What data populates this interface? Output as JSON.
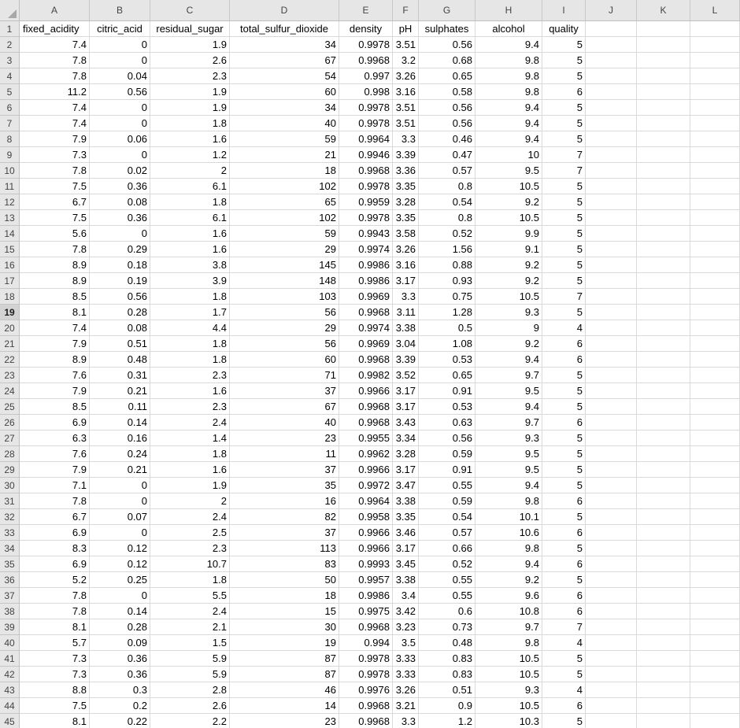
{
  "columns": [
    "A",
    "B",
    "C",
    "D",
    "E",
    "F",
    "G",
    "H",
    "I",
    "J",
    "K",
    "L"
  ],
  "headers": [
    "fixed_acidity",
    "citric_acid",
    "residual_sugar",
    "total_sulfur_dioxide",
    "density",
    "pH",
    "sulphates",
    "alcohol",
    "quality"
  ],
  "active_row": 19,
  "row_numbers": [
    "1",
    "2",
    "3",
    "4",
    "5",
    "6",
    "7",
    "8",
    "9",
    "10",
    "11",
    "12",
    "13",
    "14",
    "15",
    "16",
    "17",
    "18",
    "19",
    "20",
    "21",
    "22",
    "23",
    "24",
    "25",
    "26",
    "27",
    "28",
    "29",
    "30",
    "31",
    "32",
    "33",
    "34",
    "35",
    "36",
    "37",
    "38",
    "39",
    "40",
    "41",
    "42",
    "43",
    "44",
    "45"
  ],
  "rows": [
    [
      "7.4",
      "0",
      "1.9",
      "34",
      "0.9978",
      "3.51",
      "0.56",
      "9.4",
      "5"
    ],
    [
      "7.8",
      "0",
      "2.6",
      "67",
      "0.9968",
      "3.2",
      "0.68",
      "9.8",
      "5"
    ],
    [
      "7.8",
      "0.04",
      "2.3",
      "54",
      "0.997",
      "3.26",
      "0.65",
      "9.8",
      "5"
    ],
    [
      "11.2",
      "0.56",
      "1.9",
      "60",
      "0.998",
      "3.16",
      "0.58",
      "9.8",
      "6"
    ],
    [
      "7.4",
      "0",
      "1.9",
      "34",
      "0.9978",
      "3.51",
      "0.56",
      "9.4",
      "5"
    ],
    [
      "7.4",
      "0",
      "1.8",
      "40",
      "0.9978",
      "3.51",
      "0.56",
      "9.4",
      "5"
    ],
    [
      "7.9",
      "0.06",
      "1.6",
      "59",
      "0.9964",
      "3.3",
      "0.46",
      "9.4",
      "5"
    ],
    [
      "7.3",
      "0",
      "1.2",
      "21",
      "0.9946",
      "3.39",
      "0.47",
      "10",
      "7"
    ],
    [
      "7.8",
      "0.02",
      "2",
      "18",
      "0.9968",
      "3.36",
      "0.57",
      "9.5",
      "7"
    ],
    [
      "7.5",
      "0.36",
      "6.1",
      "102",
      "0.9978",
      "3.35",
      "0.8",
      "10.5",
      "5"
    ],
    [
      "6.7",
      "0.08",
      "1.8",
      "65",
      "0.9959",
      "3.28",
      "0.54",
      "9.2",
      "5"
    ],
    [
      "7.5",
      "0.36",
      "6.1",
      "102",
      "0.9978",
      "3.35",
      "0.8",
      "10.5",
      "5"
    ],
    [
      "5.6",
      "0",
      "1.6",
      "59",
      "0.9943",
      "3.58",
      "0.52",
      "9.9",
      "5"
    ],
    [
      "7.8",
      "0.29",
      "1.6",
      "29",
      "0.9974",
      "3.26",
      "1.56",
      "9.1",
      "5"
    ],
    [
      "8.9",
      "0.18",
      "3.8",
      "145",
      "0.9986",
      "3.16",
      "0.88",
      "9.2",
      "5"
    ],
    [
      "8.9",
      "0.19",
      "3.9",
      "148",
      "0.9986",
      "3.17",
      "0.93",
      "9.2",
      "5"
    ],
    [
      "8.5",
      "0.56",
      "1.8",
      "103",
      "0.9969",
      "3.3",
      "0.75",
      "10.5",
      "7"
    ],
    [
      "8.1",
      "0.28",
      "1.7",
      "56",
      "0.9968",
      "3.11",
      "1.28",
      "9.3",
      "5"
    ],
    [
      "7.4",
      "0.08",
      "4.4",
      "29",
      "0.9974",
      "3.38",
      "0.5",
      "9",
      "4"
    ],
    [
      "7.9",
      "0.51",
      "1.8",
      "56",
      "0.9969",
      "3.04",
      "1.08",
      "9.2",
      "6"
    ],
    [
      "8.9",
      "0.48",
      "1.8",
      "60",
      "0.9968",
      "3.39",
      "0.53",
      "9.4",
      "6"
    ],
    [
      "7.6",
      "0.31",
      "2.3",
      "71",
      "0.9982",
      "3.52",
      "0.65",
      "9.7",
      "5"
    ],
    [
      "7.9",
      "0.21",
      "1.6",
      "37",
      "0.9966",
      "3.17",
      "0.91",
      "9.5",
      "5"
    ],
    [
      "8.5",
      "0.11",
      "2.3",
      "67",
      "0.9968",
      "3.17",
      "0.53",
      "9.4",
      "5"
    ],
    [
      "6.9",
      "0.14",
      "2.4",
      "40",
      "0.9968",
      "3.43",
      "0.63",
      "9.7",
      "6"
    ],
    [
      "6.3",
      "0.16",
      "1.4",
      "23",
      "0.9955",
      "3.34",
      "0.56",
      "9.3",
      "5"
    ],
    [
      "7.6",
      "0.24",
      "1.8",
      "11",
      "0.9962",
      "3.28",
      "0.59",
      "9.5",
      "5"
    ],
    [
      "7.9",
      "0.21",
      "1.6",
      "37",
      "0.9966",
      "3.17",
      "0.91",
      "9.5",
      "5"
    ],
    [
      "7.1",
      "0",
      "1.9",
      "35",
      "0.9972",
      "3.47",
      "0.55",
      "9.4",
      "5"
    ],
    [
      "7.8",
      "0",
      "2",
      "16",
      "0.9964",
      "3.38",
      "0.59",
      "9.8",
      "6"
    ],
    [
      "6.7",
      "0.07",
      "2.4",
      "82",
      "0.9958",
      "3.35",
      "0.54",
      "10.1",
      "5"
    ],
    [
      "6.9",
      "0",
      "2.5",
      "37",
      "0.9966",
      "3.46",
      "0.57",
      "10.6",
      "6"
    ],
    [
      "8.3",
      "0.12",
      "2.3",
      "113",
      "0.9966",
      "3.17",
      "0.66",
      "9.8",
      "5"
    ],
    [
      "6.9",
      "0.12",
      "10.7",
      "83",
      "0.9993",
      "3.45",
      "0.52",
      "9.4",
      "6"
    ],
    [
      "5.2",
      "0.25",
      "1.8",
      "50",
      "0.9957",
      "3.38",
      "0.55",
      "9.2",
      "5"
    ],
    [
      "7.8",
      "0",
      "5.5",
      "18",
      "0.9986",
      "3.4",
      "0.55",
      "9.6",
      "6"
    ],
    [
      "7.8",
      "0.14",
      "2.4",
      "15",
      "0.9975",
      "3.42",
      "0.6",
      "10.8",
      "6"
    ],
    [
      "8.1",
      "0.28",
      "2.1",
      "30",
      "0.9968",
      "3.23",
      "0.73",
      "9.7",
      "7"
    ],
    [
      "5.7",
      "0.09",
      "1.5",
      "19",
      "0.994",
      "3.5",
      "0.48",
      "9.8",
      "4"
    ],
    [
      "7.3",
      "0.36",
      "5.9",
      "87",
      "0.9978",
      "3.33",
      "0.83",
      "10.5",
      "5"
    ],
    [
      "7.3",
      "0.36",
      "5.9",
      "87",
      "0.9978",
      "3.33",
      "0.83",
      "10.5",
      "5"
    ],
    [
      "8.8",
      "0.3",
      "2.8",
      "46",
      "0.9976",
      "3.26",
      "0.51",
      "9.3",
      "4"
    ],
    [
      "7.5",
      "0.2",
      "2.6",
      "14",
      "0.9968",
      "3.21",
      "0.9",
      "10.5",
      "6"
    ],
    [
      "8.1",
      "0.22",
      "2.2",
      "23",
      "0.9968",
      "3.3",
      "1.2",
      "10.3",
      "5"
    ]
  ]
}
